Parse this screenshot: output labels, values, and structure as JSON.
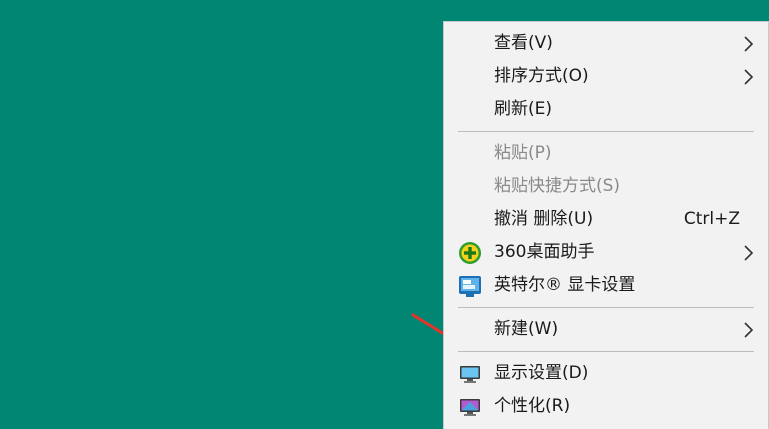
{
  "menu": {
    "items": [
      {
        "label": "查看(V)",
        "submenu": true,
        "disabled": false
      },
      {
        "label": "排序方式(O)",
        "submenu": true,
        "disabled": false
      },
      {
        "label": "刷新(E)",
        "submenu": false,
        "disabled": false
      },
      {
        "label": "粘贴(P)",
        "submenu": false,
        "disabled": true
      },
      {
        "label": "粘贴快捷方式(S)",
        "submenu": false,
        "disabled": true
      },
      {
        "label": "撤消 删除(U)",
        "shortcut": "Ctrl+Z",
        "submenu": false,
        "disabled": false
      },
      {
        "label": "360桌面助手",
        "submenu": true,
        "disabled": false,
        "icon": "360-plus-icon"
      },
      {
        "label": "英特尔® 显卡设置",
        "submenu": false,
        "disabled": false,
        "icon": "intel-graphics-icon"
      },
      {
        "label": "新建(W)",
        "submenu": true,
        "disabled": false
      },
      {
        "label": "显示设置(D)",
        "submenu": false,
        "disabled": false,
        "icon": "display-monitor-icon"
      },
      {
        "label": "个性化(R)",
        "submenu": false,
        "disabled": false,
        "icon": "personalize-monitor-icon"
      }
    ]
  },
  "colors": {
    "desktop": "#008673",
    "menu_bg": "#f2f2f2",
    "annotation_arrow": "#e8332a"
  }
}
